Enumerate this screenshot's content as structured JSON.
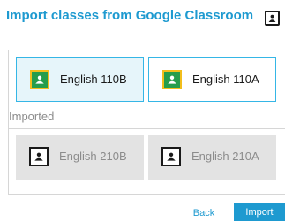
{
  "dialog": {
    "title": "Import classes from Google Classroom",
    "header_icon": "google-classroom-icon"
  },
  "classes": [
    {
      "name": "English 110B",
      "state": "selected",
      "icon": "google-classroom-icon"
    },
    {
      "name": "English 110A",
      "state": "available",
      "icon": "google-classroom-icon"
    }
  ],
  "imported": {
    "label": "Imported",
    "classes": [
      {
        "name": "English 210B",
        "state": "imported",
        "icon": "classroom-outline-icon"
      },
      {
        "name": "English 210A",
        "state": "imported",
        "icon": "classroom-outline-icon"
      }
    ]
  },
  "actions": {
    "back_label": "Back",
    "import_label": "Import"
  },
  "colors": {
    "accent": "#1e9ad0",
    "selected_background": "#e6f5fa",
    "classroom_green": "#259d4c",
    "classroom_yellow": "#f2be1c",
    "imported_background": "#e3e3e3"
  }
}
